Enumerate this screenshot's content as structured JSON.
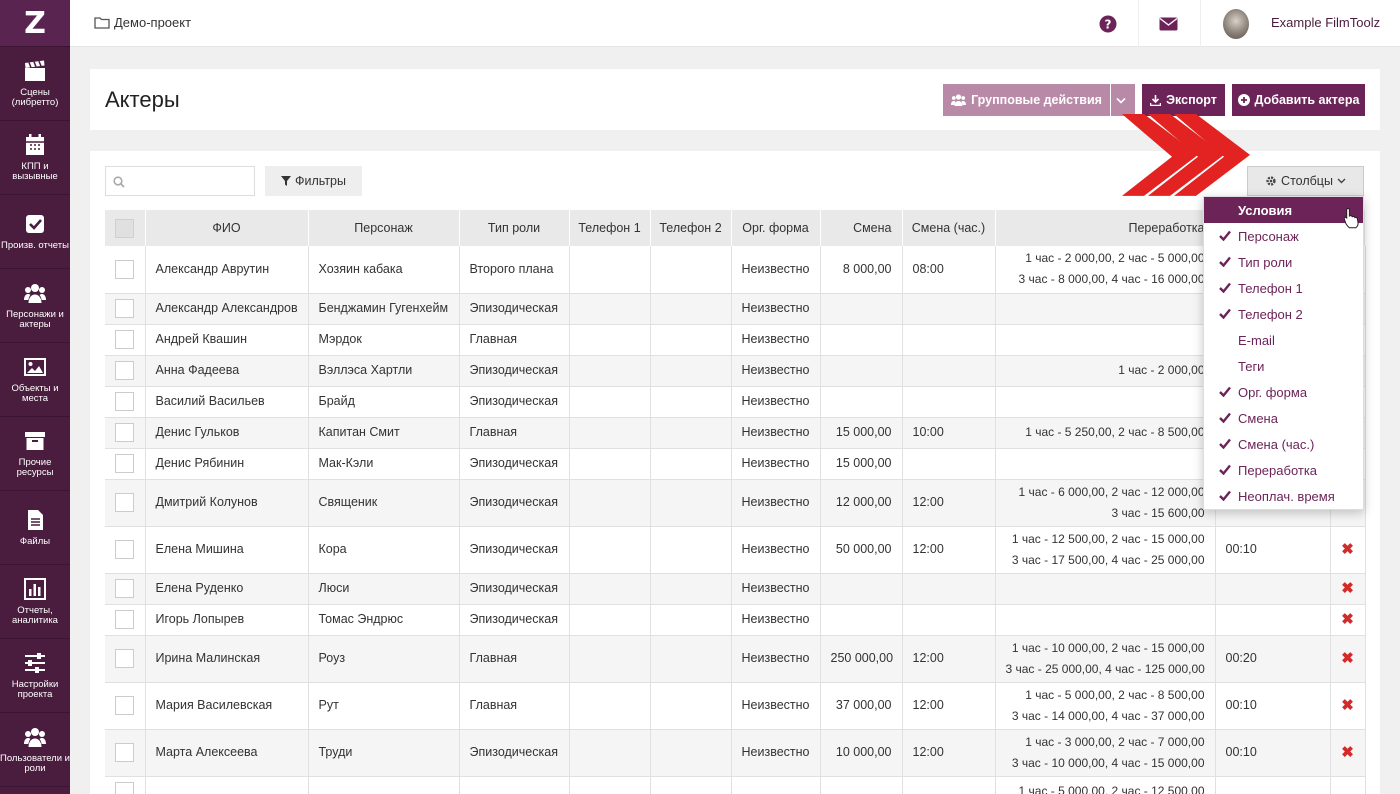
{
  "sidebar": {
    "logo": "Z",
    "items": [
      {
        "label": "Сцены (либретто)",
        "icon": "clapperboard-icon"
      },
      {
        "label": "КПП и вызывные",
        "icon": "calendar-icon"
      },
      {
        "label": "Произв. отчеты",
        "icon": "check-square-icon"
      },
      {
        "label": "Персонажи и актеры",
        "icon": "users-icon"
      },
      {
        "label": "Объекты и места",
        "icon": "image-icon"
      },
      {
        "label": "Прочие ресурсы",
        "icon": "archive-icon"
      },
      {
        "label": "Файлы",
        "icon": "file-icon"
      },
      {
        "label": "Отчеты, аналитика",
        "icon": "bar-chart-icon"
      },
      {
        "label": "Настройки проекта",
        "icon": "sliders-icon"
      },
      {
        "label": "Пользователи и роли",
        "icon": "user-group-icon"
      }
    ]
  },
  "topbar": {
    "breadcrumb": "Демо-проект",
    "user_name": "Example FilmToolz"
  },
  "header": {
    "title": "Актеры",
    "group_actions": "Групповые действия",
    "export": "Экспорт",
    "add_actor": "Добавить актера"
  },
  "toolbar": {
    "search_placeholder": "",
    "filters": "Фильтры",
    "columns": "Столбцы"
  },
  "table": {
    "headers": [
      "ФИО",
      "Персонаж",
      "Тип роли",
      "Телефон 1",
      "Телефон 2",
      "Орг. форма",
      "Смена",
      "Смена (час.)",
      "Переработка"
    ],
    "rows": [
      {
        "name": "Александр Аврутин",
        "character": "Хозяин кабака",
        "role": "Второго плана",
        "org": "Неизвестно",
        "shift": "8 000,00",
        "hours": "08:00",
        "over1": "1 час - 2 000,00, 2 час - 5 000,00",
        "over2": "3 час - 8 000,00, 4 час - 16 000,00",
        "unpaid": "",
        "del": false
      },
      {
        "name": "Александр Александров",
        "character": "Бенджамин Гугенхейм",
        "role": "Эпизодическая",
        "org": "Неизвестно",
        "shift": "",
        "hours": "",
        "over1": "",
        "over2": "",
        "unpaid": "",
        "del": false
      },
      {
        "name": "Андрей Квашин",
        "character": "Мэрдок",
        "role": "Главная",
        "org": "Неизвестно",
        "shift": "",
        "hours": "",
        "over1": "",
        "over2": "",
        "unpaid": "",
        "del": false
      },
      {
        "name": "Анна Фадеева",
        "character": "Вэллэса Хартли",
        "role": "Эпизодическая",
        "org": "Неизвестно",
        "shift": "",
        "hours": "",
        "over1": "1 час - 2 000,00",
        "over2": "",
        "unpaid": "",
        "del": false
      },
      {
        "name": "Василий Васильев",
        "character": "Брайд",
        "role": "Эпизодическая",
        "org": "Неизвестно",
        "shift": "",
        "hours": "",
        "over1": "",
        "over2": "",
        "unpaid": "",
        "del": false
      },
      {
        "name": "Денис Гульков",
        "character": "Капитан Смит",
        "role": "Главная",
        "org": "Неизвестно",
        "shift": "15 000,00",
        "hours": "10:00",
        "over1": "1 час - 5 250,00, 2 час - 8 500,00",
        "over2": "",
        "unpaid": "",
        "del": false
      },
      {
        "name": "Денис Рябинин",
        "character": "Мак-Кэли",
        "role": "Эпизодическая",
        "org": "Неизвестно",
        "shift": "15 000,00",
        "hours": "",
        "over1": "",
        "over2": "",
        "unpaid": "",
        "del": false
      },
      {
        "name": "Дмитрий Колунов",
        "character": "Священик",
        "role": "Эпизодическая",
        "org": "Неизвестно",
        "shift": "12 000,00",
        "hours": "12:00",
        "over1": "1 час - 6 000,00, 2 час - 12 000,00",
        "over2": "3 час - 15 600,00",
        "unpaid": "",
        "del": false
      },
      {
        "name": "Елена Мишина",
        "character": "Кора",
        "role": "Эпизодическая",
        "org": "Неизвестно",
        "shift": "50 000,00",
        "hours": "12:00",
        "over1": "1 час - 12 500,00, 2 час - 15 000,00",
        "over2": "3 час - 17 500,00, 4 час - 25 000,00",
        "unpaid": "00:10",
        "del": true
      },
      {
        "name": "Елена Руденко",
        "character": "Люси",
        "role": "Эпизодическая",
        "org": "Неизвестно",
        "shift": "",
        "hours": "",
        "over1": "",
        "over2": "",
        "unpaid": "",
        "del": true
      },
      {
        "name": "Игорь Лопырев",
        "character": "Томас Эндрюс",
        "role": "Эпизодическая",
        "org": "Неизвестно",
        "shift": "",
        "hours": "",
        "over1": "",
        "over2": "",
        "unpaid": "",
        "del": true
      },
      {
        "name": "Ирина Малинская",
        "character": "Роуз",
        "role": "Главная",
        "org": "Неизвестно",
        "shift": "250 000,00",
        "hours": "12:00",
        "over1": "1 час - 10 000,00, 2 час - 15 000,00",
        "over2": "3 час - 25 000,00, 4 час - 125 000,00",
        "unpaid": "00:20",
        "del": true
      },
      {
        "name": "Мария Василевская",
        "character": "Рут",
        "role": "Главная",
        "org": "Неизвестно",
        "shift": "37 000,00",
        "hours": "12:00",
        "over1": "1 час - 5 000,00, 2 час - 8 500,00",
        "over2": "3 час - 14 000,00, 4 час - 37 000,00",
        "unpaid": "00:10",
        "del": true
      },
      {
        "name": "Марта Алексеева",
        "character": "Труди",
        "role": "Эпизодическая",
        "org": "Неизвестно",
        "shift": "10 000,00",
        "hours": "12:00",
        "over1": "1 час - 3 000,00, 2 час - 7 000,00",
        "over2": "3 час - 10 000,00, 4 час - 15 000,00",
        "unpaid": "00:10",
        "del": true
      },
      {
        "name": "",
        "character": "",
        "role": "",
        "org": "",
        "shift": "",
        "hours": "",
        "over1": "1 час - 5 000,00, 2 час - 12 500,00",
        "over2": "",
        "unpaid": "",
        "del": false
      }
    ]
  },
  "columns_menu": {
    "items": [
      {
        "label": "Условия",
        "checked": false,
        "active": true
      },
      {
        "label": "Персонаж",
        "checked": true,
        "active": false
      },
      {
        "label": "Тип роли",
        "checked": true,
        "active": false
      },
      {
        "label": "Телефон 1",
        "checked": true,
        "active": false
      },
      {
        "label": "Телефон 2",
        "checked": true,
        "active": false
      },
      {
        "label": "E-mail",
        "checked": false,
        "active": false
      },
      {
        "label": "Теги",
        "checked": false,
        "active": false
      },
      {
        "label": "Орг. форма",
        "checked": true,
        "active": false
      },
      {
        "label": "Смена",
        "checked": true,
        "active": false
      },
      {
        "label": "Смена (час.)",
        "checked": true,
        "active": false
      },
      {
        "label": "Переработка",
        "checked": true,
        "active": false
      },
      {
        "label": "Неоплач. время",
        "checked": true,
        "active": false
      }
    ]
  },
  "colors": {
    "sidebar": "#4a1d3f",
    "accent": "#6c2458",
    "accent_light": "#b88aa8",
    "delete": "#d22b2b",
    "arrow": "#e32222"
  }
}
